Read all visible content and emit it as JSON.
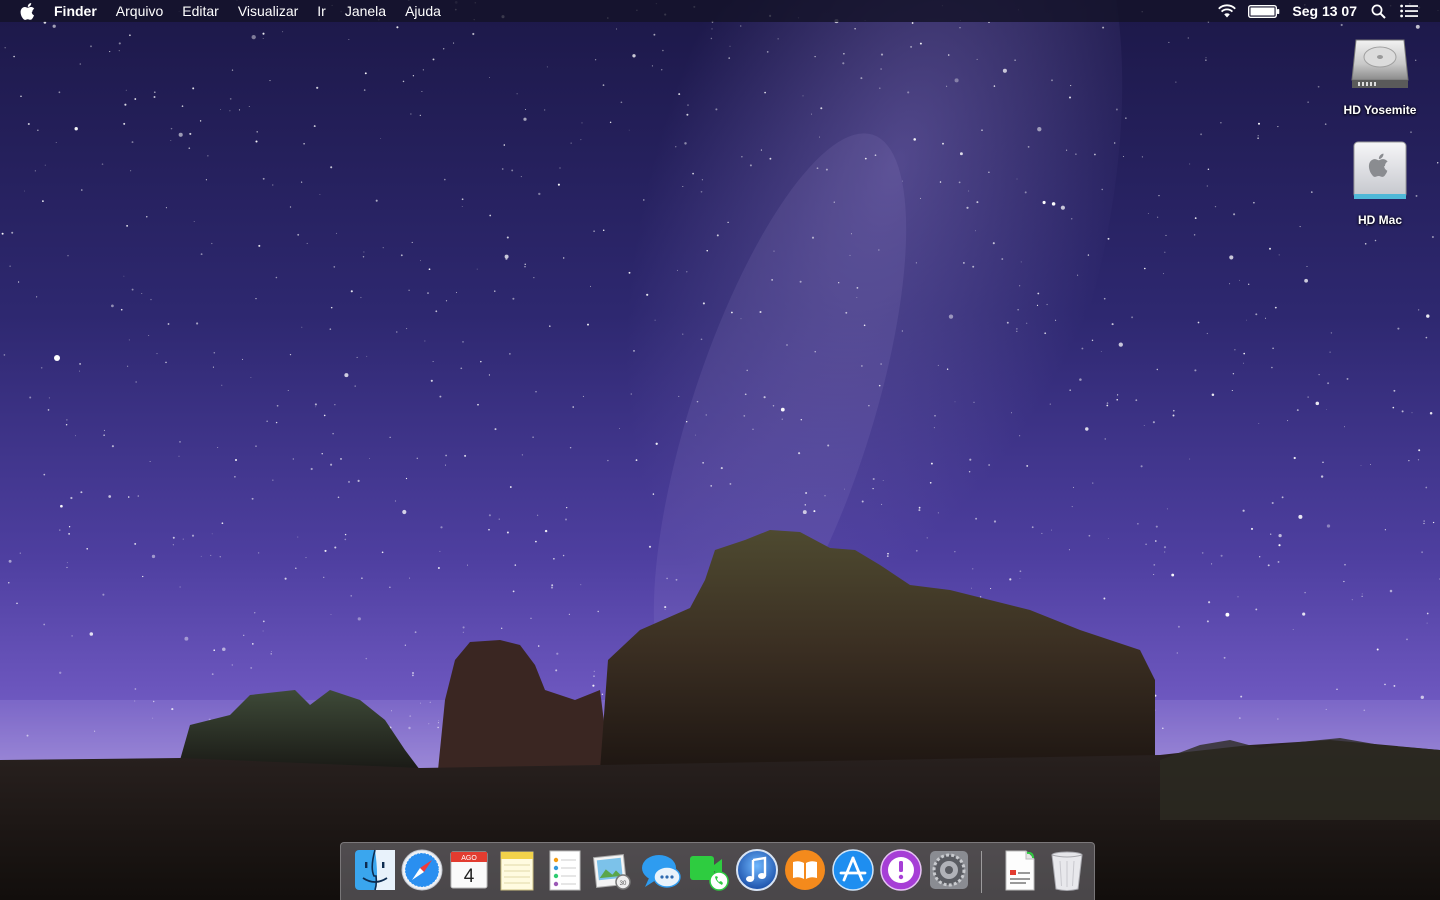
{
  "menubar": {
    "app_name": "Finder",
    "menus": [
      "Arquivo",
      "Editar",
      "Visualizar",
      "Ir",
      "Janela",
      "Ajuda"
    ],
    "clock": "Seg 13 07",
    "status_icons": [
      "wifi-icon",
      "battery-icon",
      "spotlight-search-icon",
      "notification-center-icon"
    ]
  },
  "desktop": {
    "icons": [
      {
        "label": "HD Yosemite",
        "icon": "hard-drive-icon"
      },
      {
        "label": "HD Mac",
        "icon": "apple-drive-icon"
      }
    ]
  },
  "dock": {
    "calendar": {
      "month": "AGO",
      "day": "4"
    },
    "items": [
      "finder-icon",
      "safari-icon",
      "calendar-icon",
      "notes-icon",
      "reminders-icon",
      "preview-icon",
      "messages-icon",
      "facetime-icon",
      "itunes-icon",
      "ibooks-icon",
      "app-store-icon",
      "feedback-assistant-icon",
      "system-preferences-icon",
      "document-icon",
      "trash-icon"
    ]
  },
  "colors": {
    "menubar_bg": "#16122a",
    "sky_top": "#1e1a4a",
    "sky_bottom": "#6e5cc0",
    "ground": "#1a1410"
  }
}
